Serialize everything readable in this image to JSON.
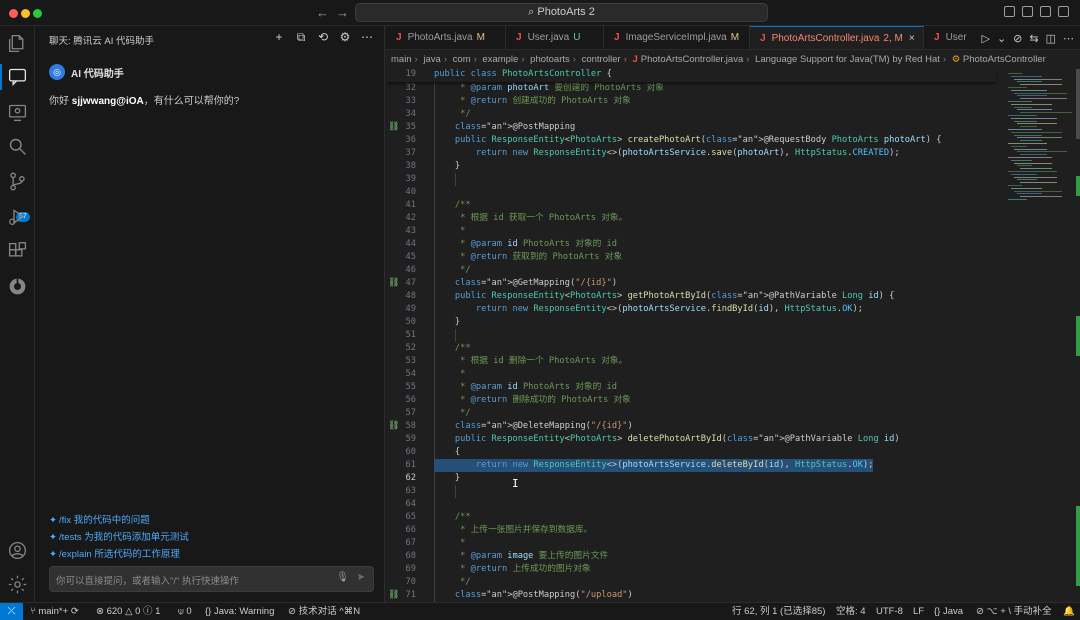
{
  "titlebar": {
    "search_label": "PhotoArts 2",
    "back_icon": "arrow-left-icon",
    "forward_icon": "arrow-right-icon"
  },
  "chat": {
    "title": "聊天: 腾讯云 AI 代码助手",
    "assistant_name": "AI 代码助手",
    "greeting_prefix": "你好 ",
    "greeting_user": "sjjwwang@iOA",
    "greeting_suffix": "，有什么可以帮你的?",
    "suggestions": [
      "/fix 我的代码中的问题",
      "/tests 为我的代码添加单元测试",
      "/explain 所选代码的工作原理"
    ],
    "input_placeholder": "你可以直接提问，或者输入\"/\" 执行快速操作"
  },
  "activity": {
    "scm_badge": "57"
  },
  "tabs": [
    {
      "name": "PhotoArts.java",
      "status": "M"
    },
    {
      "name": "User.java",
      "status": "U"
    },
    {
      "name": "ImageServiceImpl.java",
      "status": "M"
    },
    {
      "name": "PhotoArtsController.java",
      "status": "2, M"
    },
    {
      "name": "User",
      "status": ""
    }
  ],
  "breadcrumb": [
    "main",
    "java",
    "com",
    "example",
    "photoarts",
    "controller",
    "PhotoArtsController.java",
    "Language Support for Java(TM) by Red Hat",
    "PhotoArtsController"
  ],
  "code": {
    "sticky": {
      "num": "19",
      "text": "public class PhotoArtsController {"
    },
    "lines": [
      {
        "num": "32",
        "text": "     * @param photoArt 要创建的 PhotoArts 对象"
      },
      {
        "num": "33",
        "text": "     * @return 创建成功的 PhotoArts 对象"
      },
      {
        "num": "34",
        "text": "     */"
      },
      {
        "num": "35",
        "text": "    @PostMapping"
      },
      {
        "num": "36",
        "text": "    public ResponseEntity<PhotoArts> createPhotoArt(@RequestBody PhotoArts photoArt) {"
      },
      {
        "num": "37",
        "text": "        return new ResponseEntity<>(photoArtsService.save(photoArt), HttpStatus.CREATED);"
      },
      {
        "num": "38",
        "text": "    }"
      },
      {
        "num": "39",
        "text": ""
      },
      {
        "num": "40",
        "text": ""
      },
      {
        "num": "41",
        "text": "    /**"
      },
      {
        "num": "42",
        "text": "     * 根据 id 获取一个 PhotoArts 对象。"
      },
      {
        "num": "43",
        "text": "     *"
      },
      {
        "num": "44",
        "text": "     * @param id PhotoArts 对象的 id"
      },
      {
        "num": "45",
        "text": "     * @return 获取到的 PhotoArts 对象"
      },
      {
        "num": "46",
        "text": "     */"
      },
      {
        "num": "47",
        "text": "    @GetMapping(\"/{id}\")"
      },
      {
        "num": "48",
        "text": "    public ResponseEntity<PhotoArts> getPhotoArtById(@PathVariable Long id) {"
      },
      {
        "num": "49",
        "text": "        return new ResponseEntity<>(photoArtsService.findById(id), HttpStatus.OK);"
      },
      {
        "num": "50",
        "text": "    }"
      },
      {
        "num": "51",
        "text": ""
      },
      {
        "num": "52",
        "text": "    /**"
      },
      {
        "num": "53",
        "text": "     * 根据 id 删除一个 PhotoArts 对象。"
      },
      {
        "num": "54",
        "text": "     *"
      },
      {
        "num": "55",
        "text": "     * @param id PhotoArts 对象的 id"
      },
      {
        "num": "56",
        "text": "     * @return 删除成功的 PhotoArts 对象"
      },
      {
        "num": "57",
        "text": "     */"
      },
      {
        "num": "58",
        "text": "    @DeleteMapping(\"/{id}\")"
      },
      {
        "num": "59",
        "text": "    public ResponseEntity<PhotoArts> deletePhotoArtById(@PathVariable Long id)"
      },
      {
        "num": "60",
        "text": "    {"
      },
      {
        "num": "61",
        "text": "        return new ResponseEntity<>(photoArtsService.deleteById(id), HttpStatus.OK);"
      },
      {
        "num": "62",
        "text": "    }"
      },
      {
        "num": "63",
        "text": ""
      },
      {
        "num": "64",
        "text": ""
      },
      {
        "num": "65",
        "text": "    /**"
      },
      {
        "num": "66",
        "text": "     * 上传一张图片并保存到数据库。"
      },
      {
        "num": "67",
        "text": "     *"
      },
      {
        "num": "68",
        "text": "     * @param image 要上传的图片文件"
      },
      {
        "num": "69",
        "text": "     * @return 上传成功的图片对象"
      },
      {
        "num": "70",
        "text": "     */"
      },
      {
        "num": "71",
        "text": "    @PostMapping(\"/upload\")"
      }
    ]
  },
  "statusbar": {
    "branch": "main*+",
    "errors": "620",
    "warnings": "0",
    "info": "1",
    "ports": "0",
    "java": "Java: Warning",
    "tech_chat": "技术对话 ^⌘N",
    "cursor_pos": "行 62, 列 1 (已选择85)",
    "spaces": "空格: 4",
    "encoding": "UTF-8",
    "eol": "LF",
    "language": "Java",
    "completion": "⌥ + \\ 手动补全"
  },
  "colors": {
    "accent": "#0078d4",
    "error_tab": "#f48771",
    "modified": "#e2c08d",
    "untracked": "#73c991"
  }
}
